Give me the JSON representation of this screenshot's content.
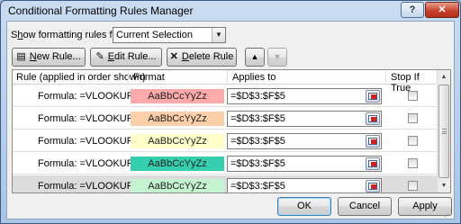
{
  "window": {
    "title": "Conditional Formatting Rules Manager",
    "help_glyph": "?",
    "close_glyph": "✕"
  },
  "filter": {
    "label_pre": "S",
    "label_ul": "h",
    "label_post": "ow formatting rules for:",
    "selected": "Current Selection"
  },
  "toolbar": {
    "new_ul": "N",
    "new_rest": "ew Rule...",
    "edit_ul": "E",
    "edit_rest": "dit Rule...",
    "delete_ul": "D",
    "delete_rest": "elete Rule",
    "up_glyph": "▲",
    "down_glyph": "▼"
  },
  "columns": {
    "rule": "Rule (applied in order shown)",
    "format": "Format",
    "applies": "Applies to",
    "stop": "Stop If True"
  },
  "rules": [
    {
      "rule": "Formula: =VLOOKUP($...",
      "preview": "AaBbCcYyZz",
      "color": "#ffaaaa",
      "applies_to": "=$D$3:$F$5",
      "stop_if_true": false,
      "selected": false
    },
    {
      "rule": "Formula: =VLOOKUP($...",
      "preview": "AaBbCcYyZz",
      "color": "#fbcfaa",
      "applies_to": "=$D$3:$F$5",
      "stop_if_true": false,
      "selected": false
    },
    {
      "rule": "Formula: =VLOOKUP($...",
      "preview": "AaBbCcYyZz",
      "color": "#ffffcc",
      "applies_to": "=$D$3:$F$5",
      "stop_if_true": false,
      "selected": false
    },
    {
      "rule": "Formula: =VLOOKUP($...",
      "preview": "AaBbCcYyZz",
      "color": "#35cfb0",
      "applies_to": "=$D$3:$F$5",
      "stop_if_true": false,
      "selected": false
    },
    {
      "rule": "Formula: =VLOOKUP($...",
      "preview": "AaBbCcYyZz",
      "color": "#c5f5d0",
      "applies_to": "=$D$3:$F$5",
      "stop_if_true": false,
      "selected": true
    }
  ],
  "footer": {
    "ok": "OK",
    "cancel": "Cancel",
    "apply": "Apply"
  }
}
